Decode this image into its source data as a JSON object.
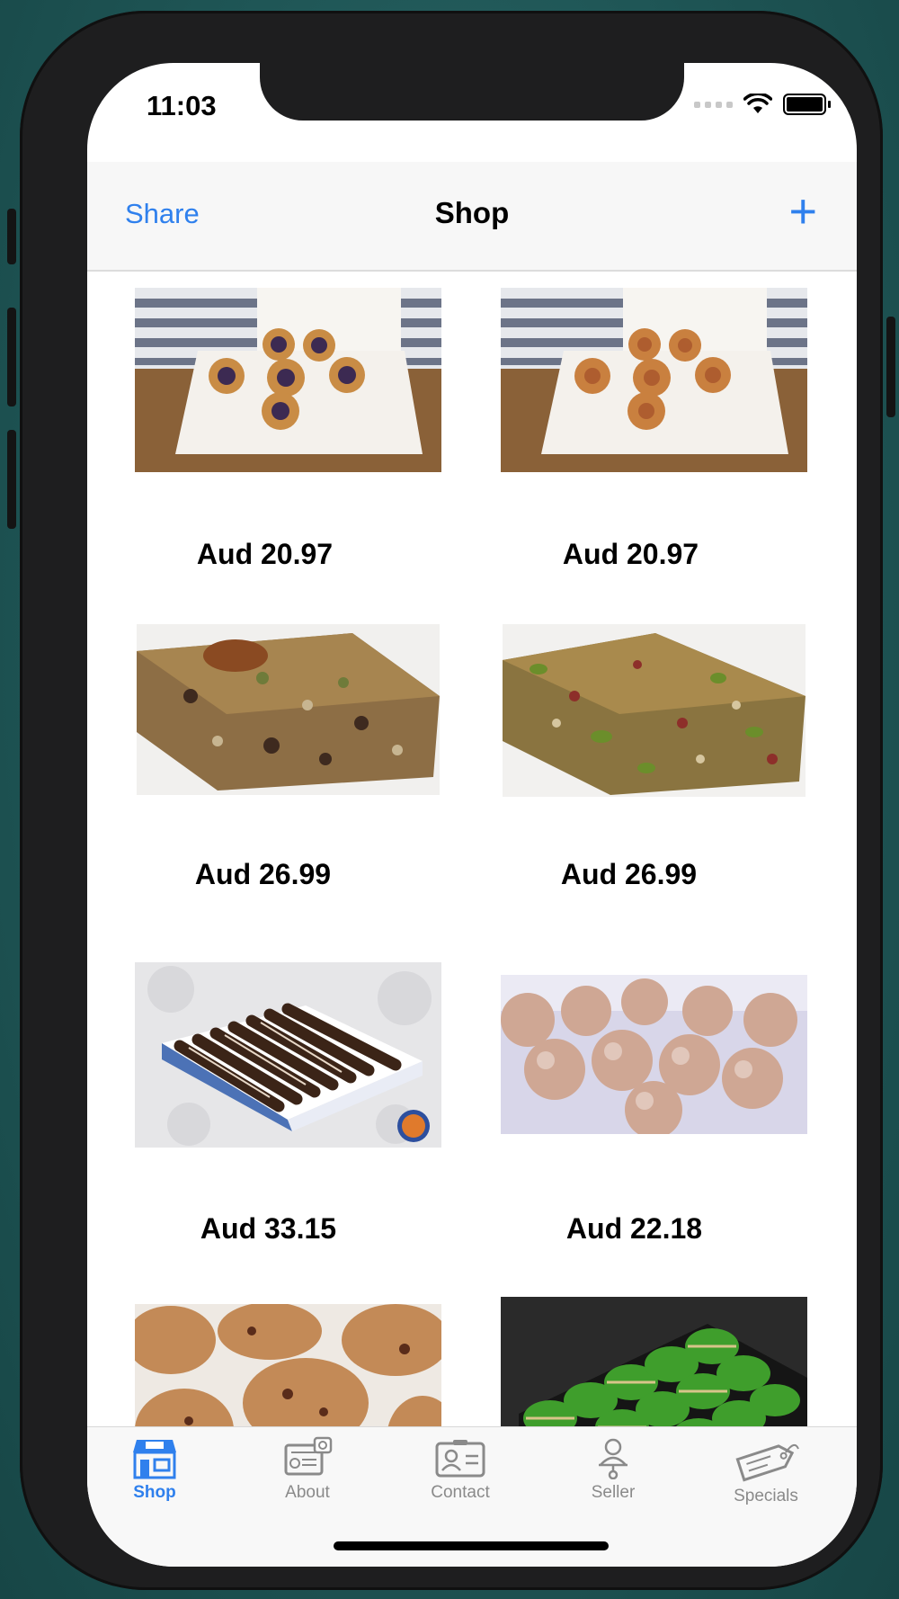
{
  "status": {
    "time": "11:03"
  },
  "navbar": {
    "left_label": "Share",
    "title": "Shop",
    "add_symbol": "+"
  },
  "products": [
    {
      "price": "Aud 20.97",
      "image": "blueberry-tarts-in-box"
    },
    {
      "price": "Aud 20.97",
      "image": "fruit-tarts-in-box"
    },
    {
      "price": "Aud 26.99",
      "image": "nut-bar-pecan"
    },
    {
      "price": "Aud 26.99",
      "image": "nut-bar-pistachio"
    },
    {
      "price": "Aud 33.15",
      "image": "chocolate-logs-tray"
    },
    {
      "price": "Aud 22.18",
      "image": "coconut-balls"
    },
    {
      "price": "",
      "image": "fruit-cookies"
    },
    {
      "price": "",
      "image": "green-macarons-tray"
    }
  ],
  "tabs": [
    {
      "label": "Shop",
      "icon": "storefront-icon",
      "active": true
    },
    {
      "label": "About",
      "icon": "about-icon",
      "active": false
    },
    {
      "label": "Contact",
      "icon": "contact-card-icon",
      "active": false
    },
    {
      "label": "Seller",
      "icon": "seller-person-icon",
      "active": false
    },
    {
      "label": "Specials",
      "icon": "price-tag-icon",
      "active": false
    }
  ],
  "colors": {
    "accent": "#2f80ed",
    "inactive": "#8a8a8a"
  }
}
